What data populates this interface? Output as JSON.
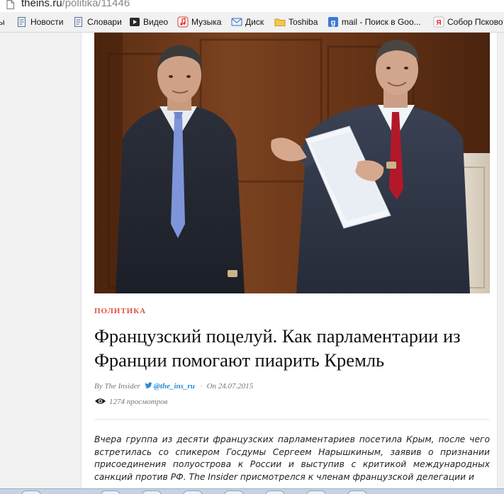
{
  "browser": {
    "url_host": "theins.ru",
    "url_path": "/politika/11446"
  },
  "bookmarks": [
    {
      "label": "ы",
      "icon": "none"
    },
    {
      "label": "Новости",
      "icon": "page-icon"
    },
    {
      "label": "Словари",
      "icon": "page-icon"
    },
    {
      "label": "Видео",
      "icon": "play-icon"
    },
    {
      "label": "Музыка",
      "icon": "music-icon"
    },
    {
      "label": "Диск",
      "icon": "mail-icon"
    },
    {
      "label": "Toshiba",
      "icon": "folder-icon"
    },
    {
      "label": "mail - Поиск в Goo...",
      "icon": "google-icon"
    },
    {
      "label": "Собор Псково",
      "icon": "yandex-icon"
    }
  ],
  "article": {
    "category": "ПОЛИТИКА",
    "title": "Французский поцелуй.  Как парламентарии из Франции помогают пиарить Кремль",
    "byline_prefix": "By The Insider",
    "twitter_handle": "@the_ins_ru",
    "separator": "·",
    "date": "On 24.07.2015",
    "views": "1274 просмотров",
    "lead": "Вчера группа из десяти французских парламентариев посетила Крым, после чего встретилась со спикером Госдумы Сергеем Нарышкиным, заявив о признании присоединения полуострова к России и выступив с критикой международных санкций против РФ. The Insider присмотрелся к членам французской делегации и"
  },
  "colors": {
    "category": "#e0523c",
    "twitter_link": "#2a8bd6",
    "headline": "#111111",
    "meta": "#777777"
  }
}
